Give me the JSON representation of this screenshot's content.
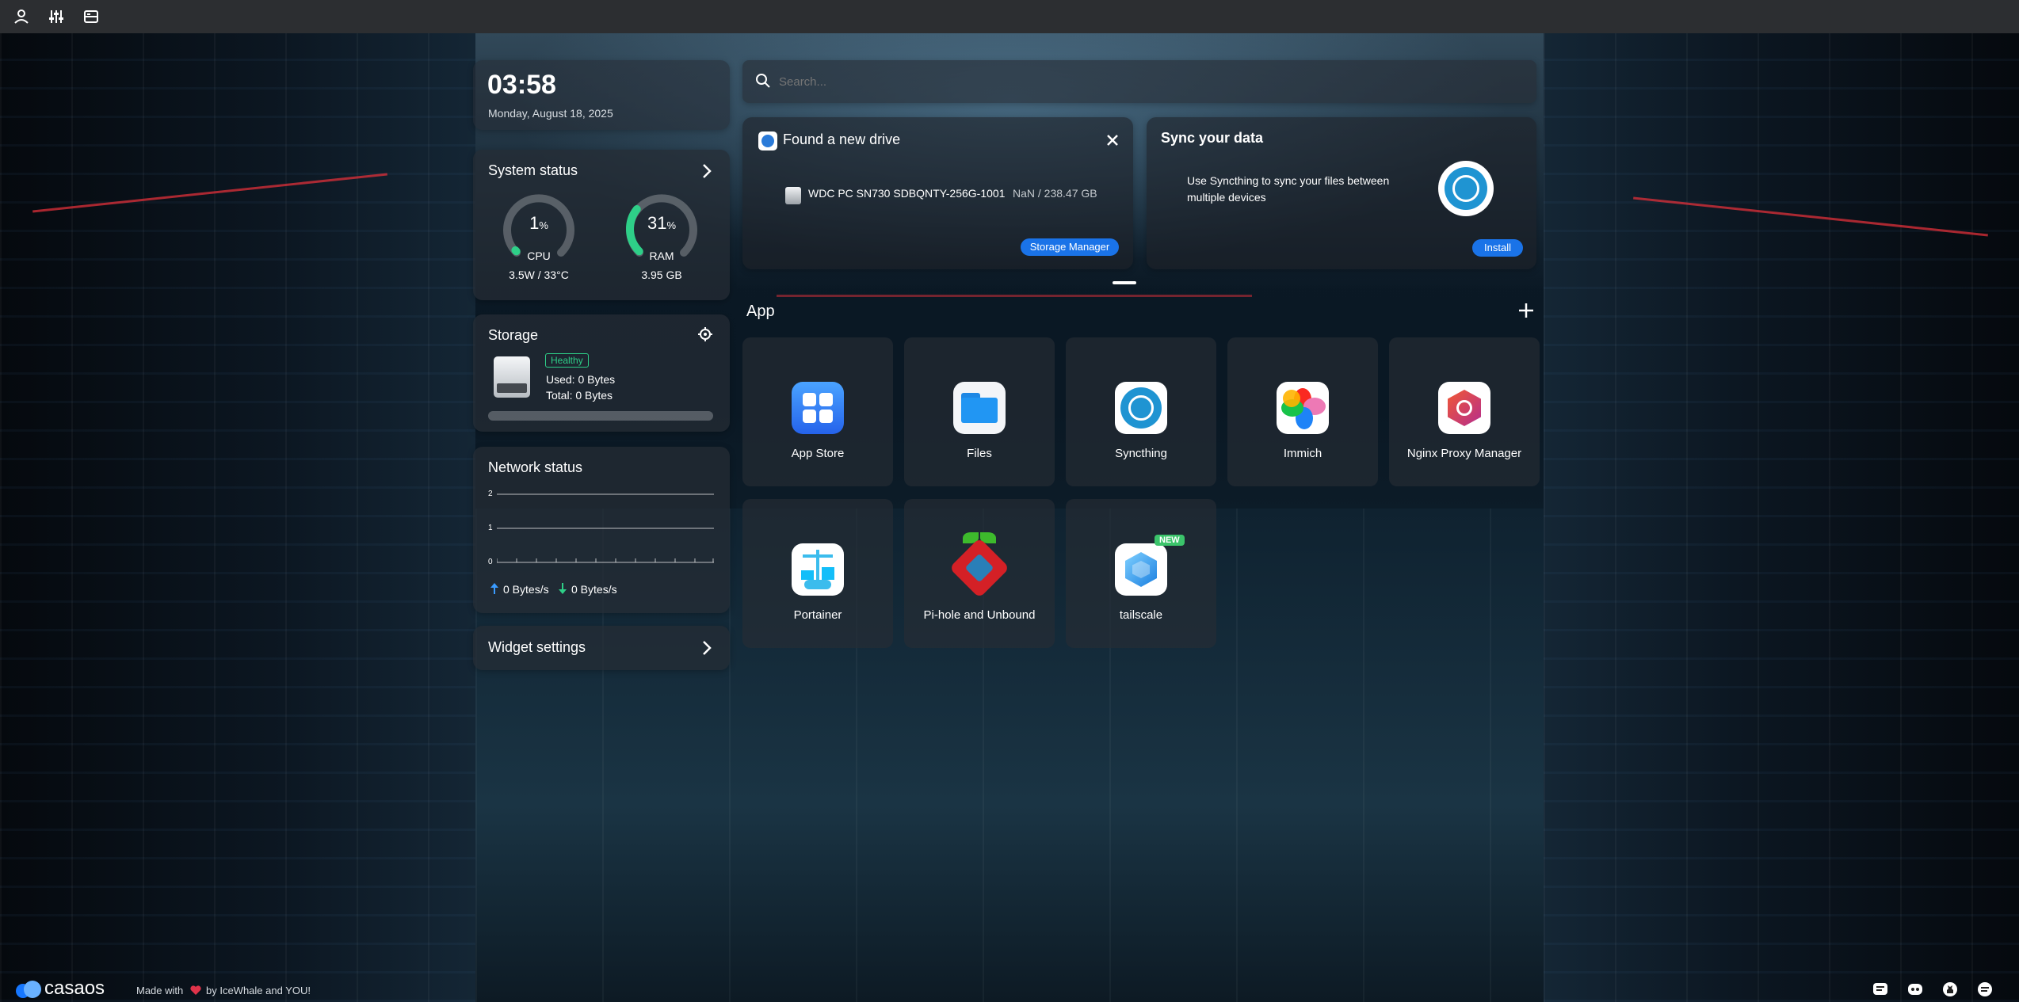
{
  "topbar": {
    "icons": [
      "user-icon",
      "sliders-icon",
      "storage-icon"
    ]
  },
  "clock": {
    "time": "03:58",
    "date": "Monday, August 18, 2025"
  },
  "system_status": {
    "title": "System status",
    "cpu": {
      "value": "1",
      "unit": "%",
      "label": "CPU",
      "detail": "3.5W / 33°C",
      "percent": 1
    },
    "ram": {
      "value": "31",
      "unit": "%",
      "label": "RAM",
      "detail": "3.95 GB",
      "percent": 31
    }
  },
  "storage": {
    "title": "Storage",
    "badge": "Healthy",
    "used": "Used: 0 Bytes",
    "total": "Total: 0 Bytes",
    "used_fraction": 0
  },
  "network": {
    "title": "Network status",
    "y_ticks": [
      "2",
      "1",
      "0"
    ],
    "upload": "0 Bytes/s",
    "download": "0 Bytes/s"
  },
  "widget_settings": {
    "label": "Widget settings"
  },
  "search": {
    "placeholder": "Search..."
  },
  "drive_notice": {
    "title": "Found a new drive",
    "drive_name": "WDC PC SN730 SDBQNTY-256G-1001",
    "drive_size": "NaN / 238.47 GB",
    "button": "Storage Manager"
  },
  "sync_notice": {
    "title": "Sync your data",
    "text": "Use Syncthing to sync your files between multiple devices",
    "button": "Install"
  },
  "apps": {
    "title": "App",
    "items": [
      {
        "name": "App Store",
        "icon": "app-store-icon"
      },
      {
        "name": "Files",
        "icon": "files-icon"
      },
      {
        "name": "Syncthing",
        "icon": "syncthing-icon"
      },
      {
        "name": "Immich",
        "icon": "immich-icon"
      },
      {
        "name": "Nginx Proxy Manager",
        "icon": "nginx-proxy-manager-icon"
      },
      {
        "name": "Portainer",
        "icon": "portainer-icon"
      },
      {
        "name": "Pi-hole and Unbound",
        "icon": "pihole-icon"
      },
      {
        "name": "tailscale",
        "icon": "tailscale-icon",
        "badge": "NEW"
      }
    ]
  },
  "footer": {
    "brand": "casaos",
    "made_with": "Made with",
    "by": "by IceWhale and YOU!",
    "icons": [
      "feedback-icon",
      "discord-icon",
      "github-icon",
      "chat-icon"
    ]
  },
  "colors": {
    "accent": "#1a73e8",
    "healthy": "#2ecf88",
    "gauge": "#2ecf88"
  }
}
